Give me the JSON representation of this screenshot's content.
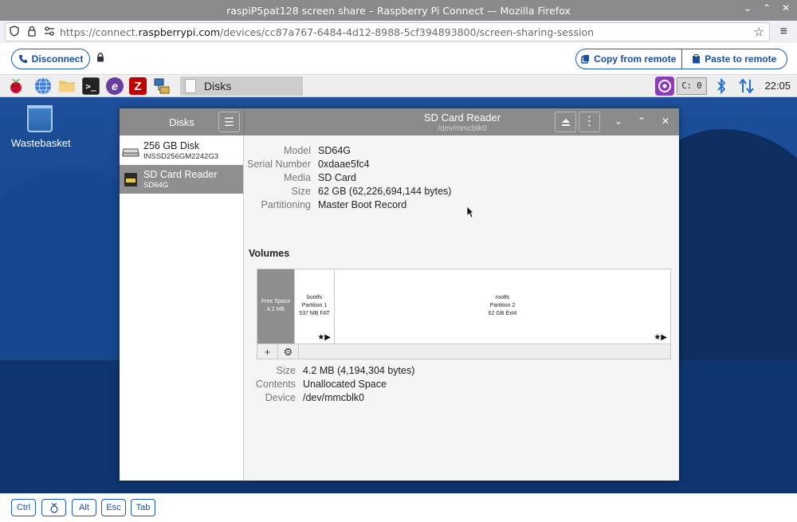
{
  "browser": {
    "window_title": "raspiP5pat128 screen share – Raspberry Pi Connect — Mozilla Firefox",
    "url_prefix": "https://connect.",
    "url_domain": "raspberrypi.com",
    "url_path": "/devices/cc87a767-6484-4d12-8988-5cf394893800/screen-sharing-session"
  },
  "connect": {
    "disconnect_label": "Disconnect",
    "copy_label": "Copy from remote",
    "paste_label": "Paste to remote",
    "accent": "#1a5bb5"
  },
  "taskbar": {
    "task_label": "Disks",
    "keyboard_indicator": "C: 0",
    "clock": "22:05"
  },
  "desktop": {
    "trash_label": "Wastebasket"
  },
  "disks": {
    "sidebar_title": "Disks",
    "devices": [
      {
        "name": "256 GB Disk",
        "sub": "INSSD256GM2242G3"
      },
      {
        "name": "SD Card Reader",
        "sub": "SD64G"
      }
    ],
    "header_title": "SD Card Reader",
    "header_sub": "/dev/mmcblk0",
    "info": [
      {
        "k": "Model",
        "v": "SD64G"
      },
      {
        "k": "Serial Number",
        "v": "0xdaae5fc4"
      },
      {
        "k": "Media",
        "v": "SD Card"
      },
      {
        "k": "Size",
        "v": "62 GB (62,226,694,144 bytes)"
      },
      {
        "k": "Partitioning",
        "v": "Master Boot Record"
      }
    ],
    "volumes_heading": "Volumes",
    "segments": [
      {
        "l1": "Free Space",
        "l2": "4.2 MB",
        "l3": ""
      },
      {
        "l1": "bootfs",
        "l2": "Partition 1",
        "l3": "537 MB FAT"
      },
      {
        "l1": "rootfs",
        "l2": "Partition 2",
        "l3": "62 GB Ext4"
      }
    ],
    "volume_info": [
      {
        "k": "Size",
        "v": "4.2 MB (4,194,304 bytes)"
      },
      {
        "k": "Contents",
        "v": "Unallocated Space"
      },
      {
        "k": "Device",
        "v": "/dev/mmcblk0"
      }
    ]
  },
  "keys": {
    "ctrl": "Ctrl",
    "alt": "Alt",
    "esc": "Esc",
    "tab": "Tab"
  }
}
